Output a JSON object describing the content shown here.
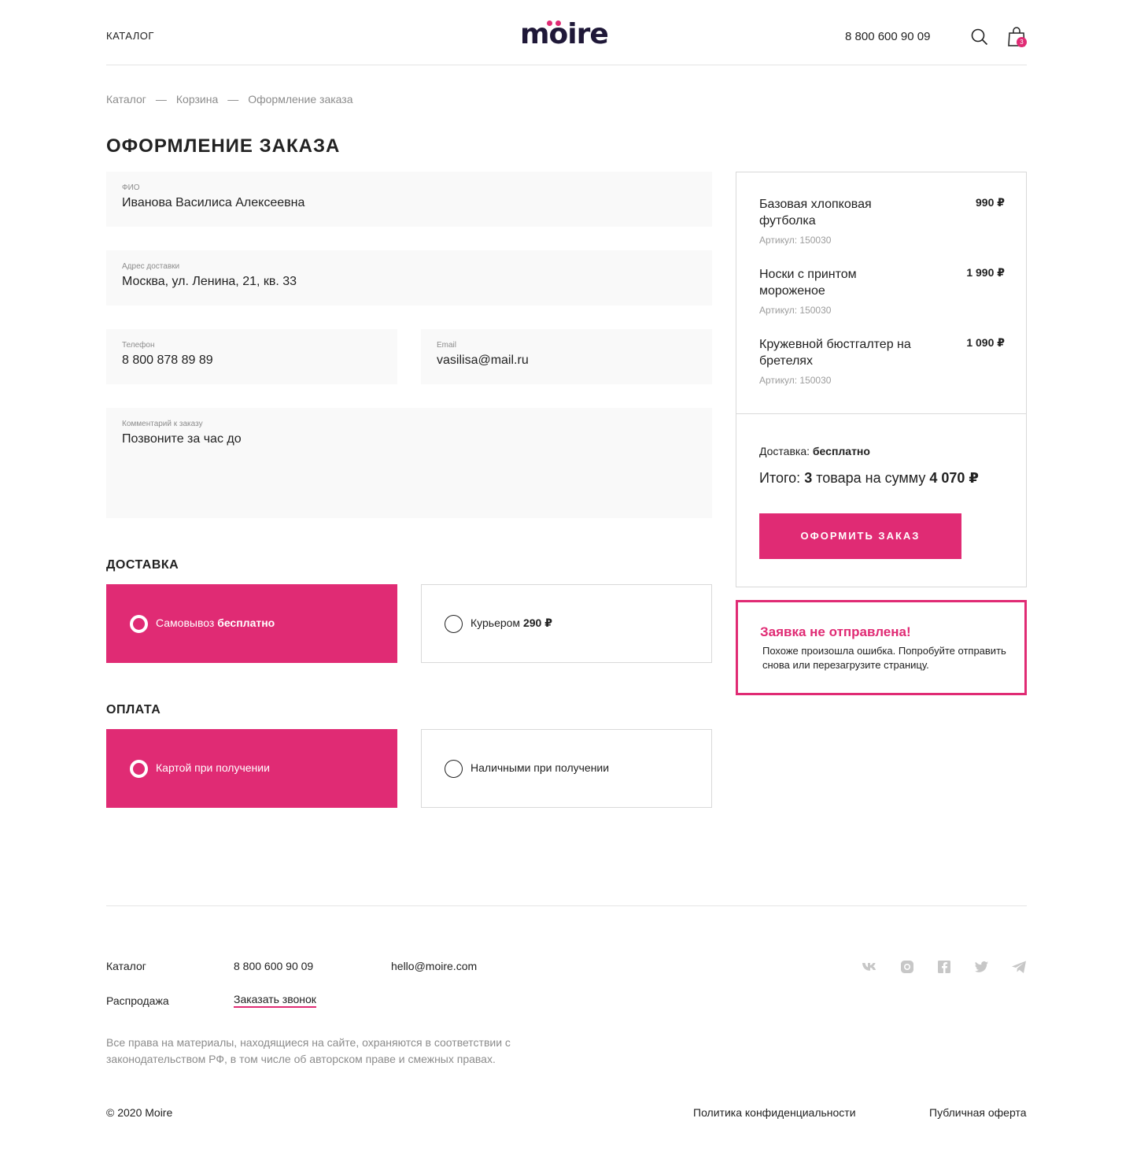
{
  "header": {
    "catalog_label": "КАТАЛОГ",
    "logo_text": "moire",
    "phone": "8 800 600 90 09",
    "cart_count": "3"
  },
  "breadcrumbs": [
    "Каталог",
    "Корзина",
    "Оформление заказа"
  ],
  "breadcrumb_separator": "—",
  "page_title": "ОФОРМЛЕНИЕ ЗАКАЗА",
  "form": {
    "name": {
      "label": "ФИО",
      "value": "Иванова Василиса Алексеевна"
    },
    "address": {
      "label": "Адрес доставки",
      "value": "Москва, ул. Ленина, 21, кв. 33"
    },
    "phone": {
      "label": "Телефон",
      "value": "8 800 878 89 89"
    },
    "email": {
      "label": "Email",
      "value": "vasilisa@mail.ru"
    },
    "comment": {
      "label": "Комментарий к заказу",
      "value": "Позвоните за час до"
    }
  },
  "delivery": {
    "title": "ДОСТАВКА",
    "options": [
      {
        "label": "Самовывоз",
        "price": "бесплатно",
        "selected": true
      },
      {
        "label": "Курьером",
        "price": "290 ₽",
        "selected": false
      }
    ]
  },
  "payment": {
    "title": "ОПЛАТА",
    "options": [
      {
        "label": "Картой при получении",
        "selected": true
      },
      {
        "label": "Наличными при получении",
        "selected": false
      }
    ]
  },
  "summary": {
    "items": [
      {
        "name": "Базовая хлопковая футболка",
        "price": "990 ₽",
        "sku": "Артикул: 150030"
      },
      {
        "name": "Носки с принтом мороженое",
        "price": "1 990 ₽",
        "sku": "Артикул: 150030"
      },
      {
        "name": "Кружевной бюстгалтер на бретелях",
        "price": "1 090 ₽",
        "sku": "Артикул: 150030"
      }
    ],
    "delivery_label": "Доставка:",
    "delivery_value": "бесплатно",
    "total_prefix": "Итого:",
    "total_count": "3",
    "total_middle": "товара на сумму",
    "total_sum": "4 070 ₽",
    "submit_label": "ОФОРМИТЬ ЗАКАЗ"
  },
  "error": {
    "title": "Заявка не отправлена!",
    "text": "Похоже произошла ошибка. Попробуйте отправить снова или перезагрузите страницу."
  },
  "footer": {
    "catalog": "Каталог",
    "sale": "Распродажа",
    "phone": "8 800 600 90 09",
    "callback": "Заказать звонок",
    "email": "hello@moire.com",
    "social_icons": [
      "vk-icon",
      "instagram-icon",
      "facebook-icon",
      "twitter-icon",
      "telegram-icon"
    ],
    "copyright_note": "Все права на материалы, находящиеся на сайте, охраняются в соответствии с законодательством РФ, в том числе об авторском праве и смежных правах.",
    "copyright": "© 2020 Moire",
    "privacy": "Политика конфиденциальности",
    "offer": "Публичная оферта"
  },
  "colors": {
    "accent": "#e02b74",
    "logo": "#1f1838",
    "field_bg": "#f9f9f9",
    "social_icon": "#c7c7c7"
  }
}
